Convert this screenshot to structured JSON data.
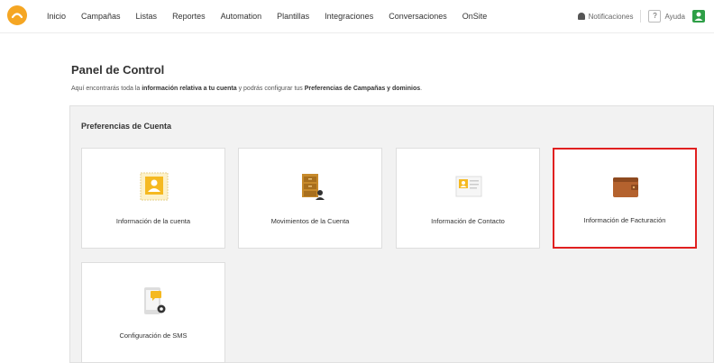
{
  "nav": {
    "items": [
      {
        "label": "Inicio",
        "name": "nav-inicio"
      },
      {
        "label": "Campañas",
        "name": "nav-campanas"
      },
      {
        "label": "Listas",
        "name": "nav-listas"
      },
      {
        "label": "Reportes",
        "name": "nav-reportes"
      },
      {
        "label": "Automation",
        "name": "nav-automation"
      },
      {
        "label": "Plantillas",
        "name": "nav-plantillas"
      },
      {
        "label": "Integraciones",
        "name": "nav-integraciones"
      },
      {
        "label": "Conversaciones",
        "name": "nav-conversaciones"
      },
      {
        "label": "OnSite",
        "name": "nav-onsite"
      }
    ],
    "notifications_label": "Notificaciones",
    "help_label": "Ayuda",
    "help_glyph": "?"
  },
  "page": {
    "title": "Panel de Control",
    "desc_1": "Aquí encontrarás toda la ",
    "desc_bold_1": "información relativa a tu cuenta",
    "desc_2": " y podrás configurar tus ",
    "desc_bold_2": "Preferencias de Campañas y dominios",
    "desc_3": "."
  },
  "panel": {
    "title": "Preferencias de Cuenta",
    "cards": [
      {
        "label": "Información de la cuenta",
        "icon": "account-info-icon"
      },
      {
        "label": "Movimientos de la Cuenta",
        "icon": "account-movements-icon"
      },
      {
        "label": "Información de Contacto",
        "icon": "contact-card-icon"
      },
      {
        "label": "Información de Facturación",
        "icon": "wallet-icon",
        "selected": true
      },
      {
        "label": "Configuración de SMS",
        "icon": "sms-phone-icon"
      }
    ]
  },
  "colors": {
    "accent": "#f5a623",
    "user": "#2e9f47",
    "selected_border": "#e02020"
  }
}
